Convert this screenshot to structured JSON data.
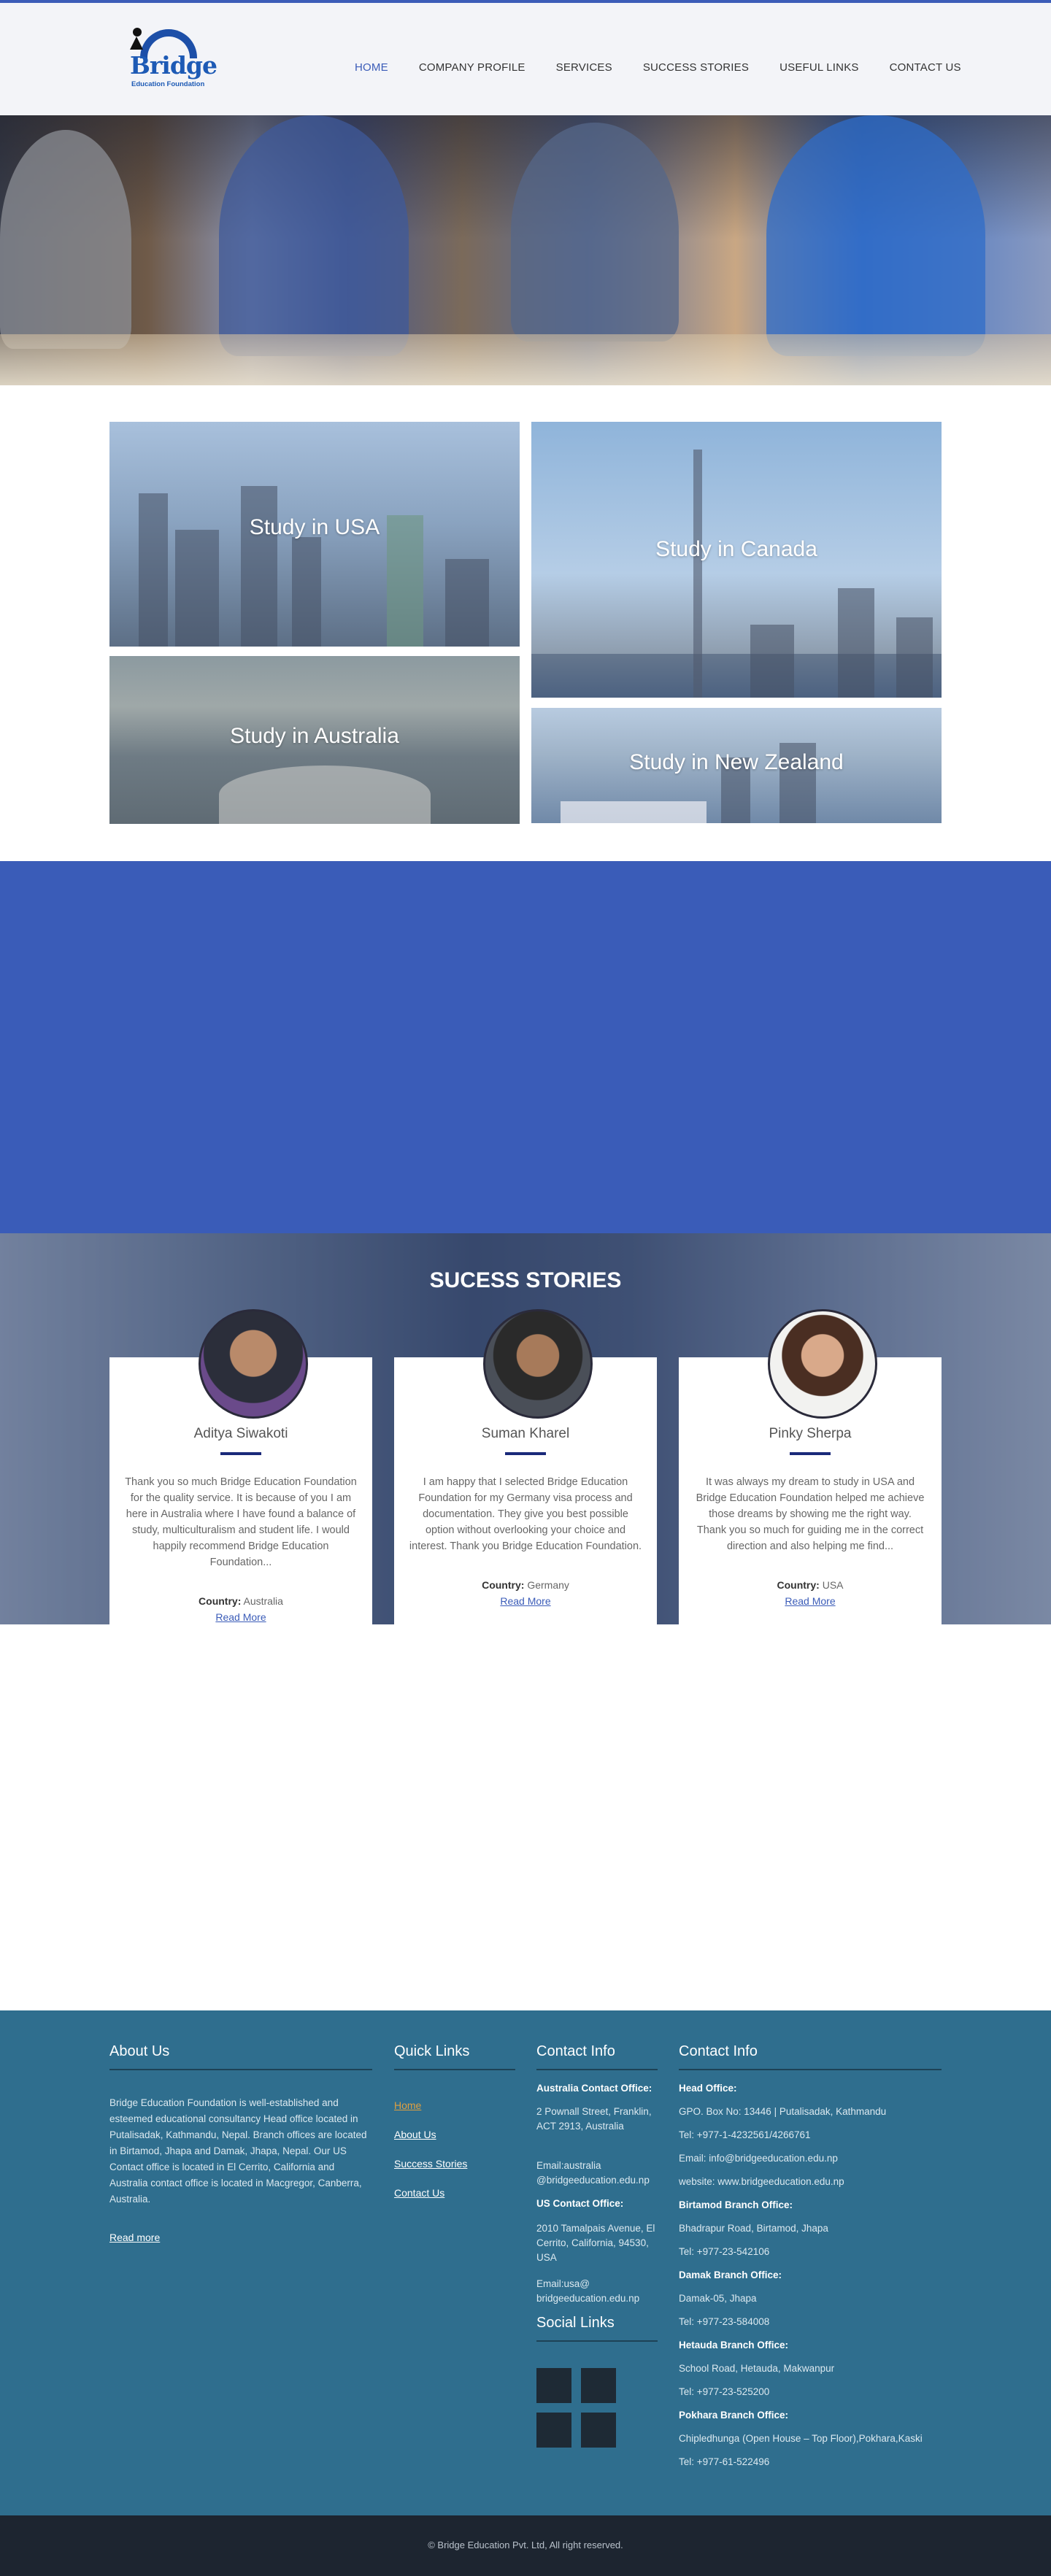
{
  "brand": {
    "name": "Bridge",
    "sub": "Education Foundation"
  },
  "nav": [
    {
      "label": "HOME",
      "active": true
    },
    {
      "label": "COMPANY PROFILE",
      "active": false
    },
    {
      "label": "SERVICES",
      "active": false
    },
    {
      "label": "SUCCESS STORIES",
      "active": false
    },
    {
      "label": "USEFUL LINKS",
      "active": false
    },
    {
      "label": "CONTACT US",
      "active": false
    }
  ],
  "destinations": {
    "usa": "Study in USA",
    "australia": "Study in Australia",
    "canada": "Study in Canada",
    "new_zealand": "Study in New Zealand"
  },
  "stories": {
    "title": "SUCESS STORIES",
    "items": [
      {
        "name": "Aditya Siwakoti",
        "quote": "Thank you so much Bridge Education Foundation for the quality service. It is because of you I am here in Australia where I have found a balance of study, multiculturalism and student life. I would happily recommend Bridge Education Foundation...",
        "country_label": "Country:",
        "country": "Australia",
        "read_more": "Read More"
      },
      {
        "name": "Suman Kharel",
        "quote": "I am happy that I selected Bridge Education Foundation for my Germany visa process and documentation. They give you best possible option without overlooking your choice and interest. Thank you Bridge Education Foundation.",
        "country_label": "Country:",
        "country": "Germany",
        "read_more": "Read More"
      },
      {
        "name": "Pinky Sherpa",
        "quote": "It was always my dream to study in USA and Bridge Education Foundation helped me achieve those dreams by showing me the right way. Thank you so much for guiding me in the correct direction and also helping me find...",
        "country_label": "Country:",
        "country": "USA",
        "read_more": "Read More"
      }
    ]
  },
  "footer": {
    "about": {
      "title": "About Us",
      "text": "Bridge Education Foundation is well-established and esteemed educational consultancy Head office located in Putalisadak, Kathmandu, Nepal. Branch offices are located in Birtamod, Jhapa and Damak, Jhapa, Nepal. Our US Contact office is located in El Cerrito, California and Australia contact office is located in Macgregor, Canberra, Australia.",
      "read_more": "Read more"
    },
    "quick_links": {
      "title": "Quick Links",
      "items": [
        "Home",
        "About Us",
        "Success Stories",
        "Contact Us"
      ]
    },
    "contact_left": {
      "title": "Contact Info",
      "aus_heading": "Australia Contact Office:",
      "aus_address": "2 Pownall Street, Franklin, ACT 2913, Australia",
      "aus_email": "Email:australia @bridgeeducation.edu.np",
      "us_heading": "US Contact Office:",
      "us_address": "2010 Tamalpais Avenue, El Cerrito, California, 94530, USA",
      "us_email": "Email:usa@ bridgeeducation.edu.np"
    },
    "social": {
      "title": "Social Links"
    },
    "contact_right": {
      "title": "Contact Info",
      "head_heading": "Head Office:",
      "head_box": "GPO. Box No: 13446 | Putalisadak, Kathmandu",
      "head_tel": "Tel: +977-1-4232561/4266761",
      "head_email": "Email: info@bridgeeducation.edu.np",
      "head_web": "website: www.bridgeeducation.edu.np",
      "birtamod_heading": "Birtamod Branch Office:",
      "birtamod_addr": "Bhadrapur Road, Birtamod, Jhapa",
      "birtamod_tel": "Tel: +977-23-542106",
      "damak_heading": "Damak Branch Office:",
      "damak_addr": "Damak-05, Jhapa",
      "damak_tel": "Tel: +977-23-584008",
      "hetauda_heading": "Hetauda Branch Office:",
      "hetauda_addr": "School Road, Hetauda, Makwanpur",
      "hetauda_tel": "Tel: +977-23-525200",
      "pokhara_heading": "Pokhara Branch Office:",
      "pokhara_addr": "Chipledhunga (Open House – Top Floor),Pokhara,Kaski",
      "pokhara_tel": "Tel: +977-61-522496"
    },
    "copyright": "© Bridge Education Pvt. Ltd, All right reserved."
  }
}
